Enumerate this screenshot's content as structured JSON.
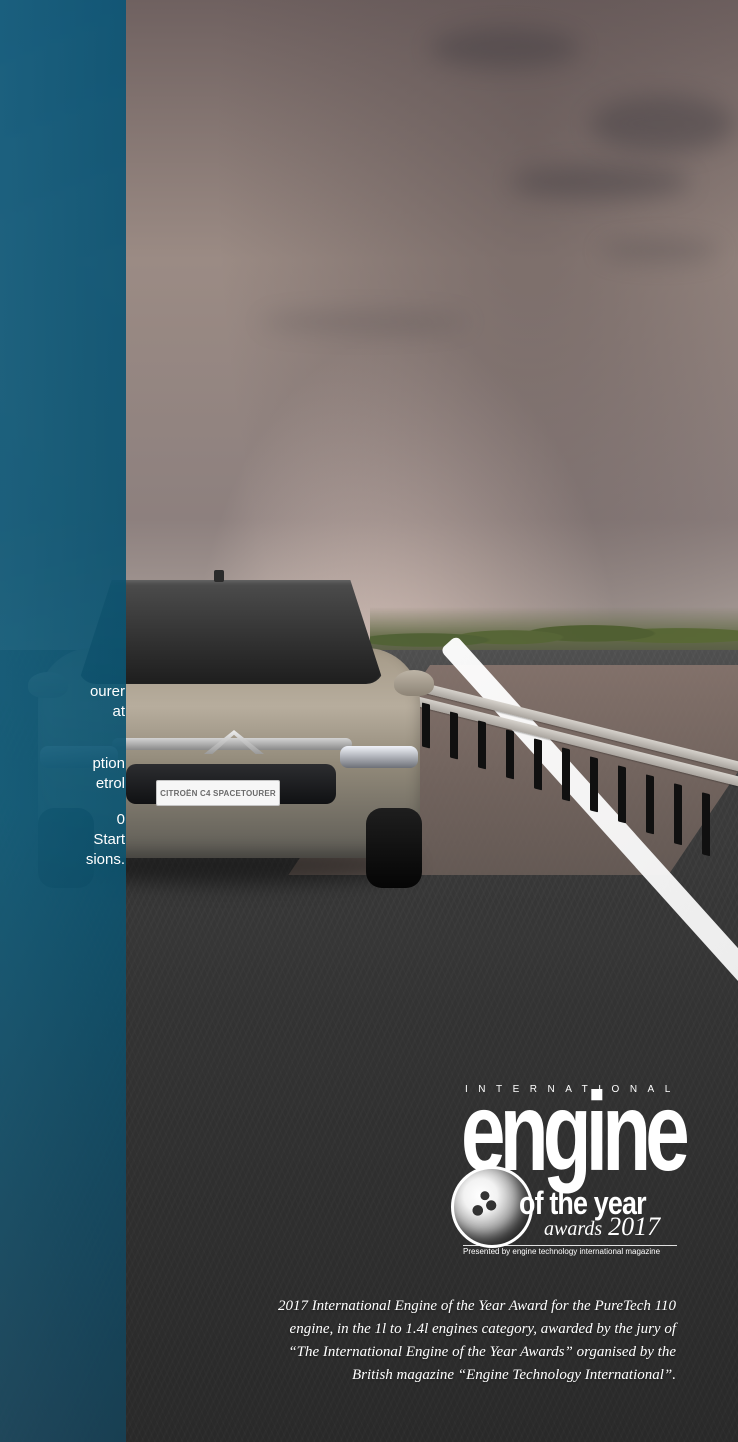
{
  "left_panel": {
    "text_lines": [
      "ourer",
      "at",
      "ption",
      "etrol",
      "0",
      "Start",
      "sions."
    ]
  },
  "car": {
    "plate": "CITROËN C4 SPACETOURER"
  },
  "logo": {
    "top_text": "INTERNATIONAL",
    "main_text": "engine",
    "subtitle": "of the year",
    "awards_text": "awards",
    "year": "2017",
    "presented_text": "Presented by engine technology international magazine"
  },
  "caption": {
    "line_1": "2017 International Engine of the Year Award for the PureTech 110",
    "line_2": "engine, in the 1l to 1.4l engines category, awarded by the jury of",
    "line_3": "“The International Engine of the Year Awards” organised by the",
    "line_4": "British magazine “Engine Technology International”."
  },
  "colors": {
    "sidebar": "#0c5a7d",
    "road": "#353535",
    "sky": "#d8c8c1",
    "text": "#ffffff"
  }
}
